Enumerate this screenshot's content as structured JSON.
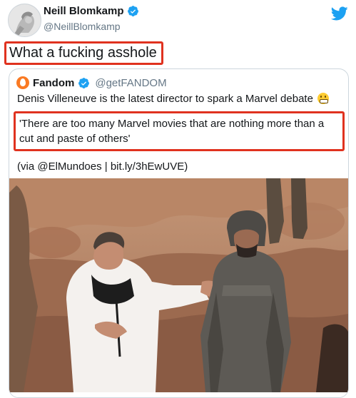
{
  "tweet": {
    "author_name": "Neill Blomkamp",
    "author_handle": "@NeillBlomkamp",
    "text": "What a fucking asshole"
  },
  "quoted": {
    "author_name": "Fandom",
    "author_handle": "@getFANDOM",
    "headline": "Denis Villeneuve is the latest director to spark a Marvel debate",
    "quote": "'There are too many Marvel movies that are nothing more than a cut and paste of others'",
    "via": "(via @ElMundoes | bit.ly/3hEwUVE)"
  },
  "icons": {
    "verified": "verified-badge-icon",
    "brand": "twitter-bird-icon",
    "emoji": "grimacing-face-emoji"
  },
  "colors": {
    "highlight_box": "#e0321f",
    "verified_blue": "#1da1f2",
    "fandom_orange": "#fa7a23"
  }
}
